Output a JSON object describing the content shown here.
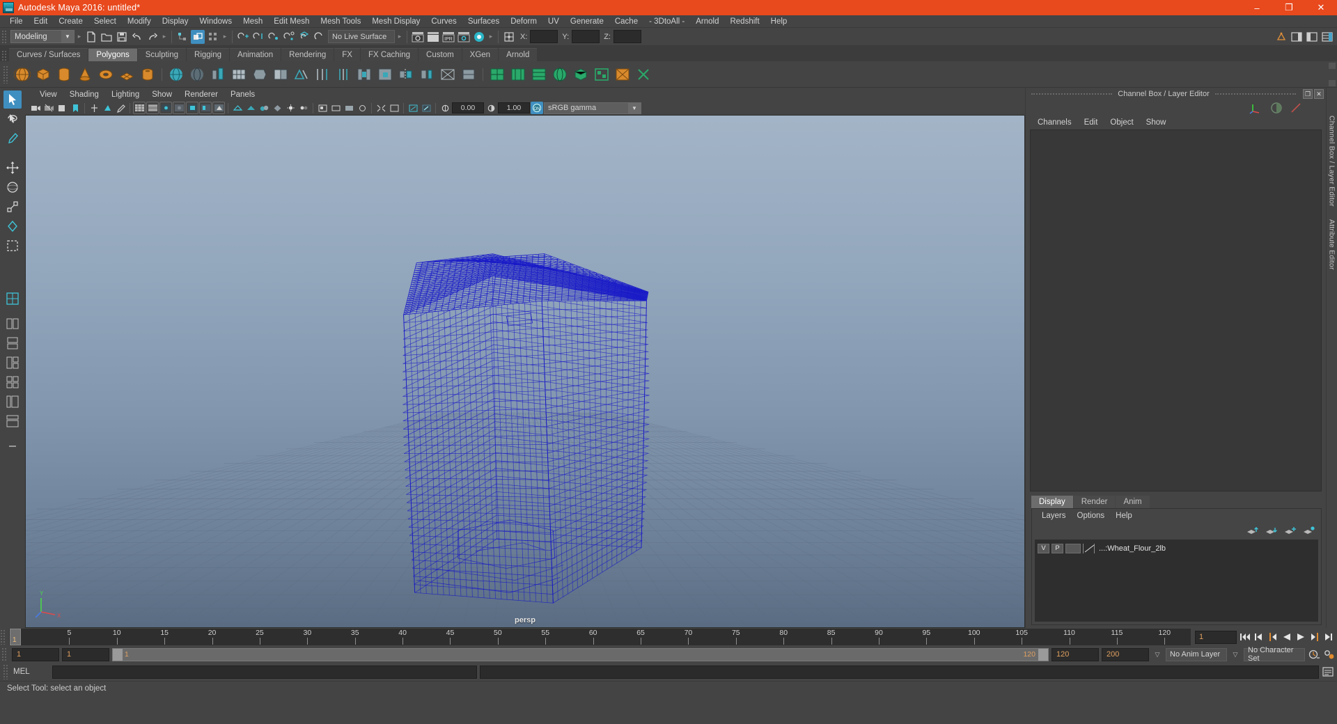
{
  "window": {
    "title": "Autodesk Maya 2016: untitled*",
    "minimize": "–",
    "maximize": "❐",
    "close": "✕",
    "titlebar_color": "#e8491d"
  },
  "menubar": {
    "items": [
      "File",
      "Edit",
      "Create",
      "Select",
      "Modify",
      "Display",
      "Windows",
      "Mesh",
      "Edit Mesh",
      "Mesh Tools",
      "Mesh Display",
      "Curves",
      "Surfaces",
      "Deform",
      "UV",
      "Generate",
      "Cache",
      "- 3DtoAll -",
      "Arnold",
      "Redshift",
      "Help"
    ]
  },
  "statusline": {
    "menu_set": "Modeling",
    "live_surface": "No Live Surface",
    "coord_x_label": "X:",
    "coord_y_label": "Y:",
    "coord_z_label": "Z:",
    "coord_x_value": "",
    "coord_y_value": "",
    "coord_z_value": "",
    "active_snap_icon": "snap-to-grid-icon"
  },
  "shelf": {
    "tabs": [
      {
        "label": "Curves / Surfaces",
        "selected": false
      },
      {
        "label": "Polygons",
        "selected": true
      },
      {
        "label": "Sculpting",
        "selected": false
      },
      {
        "label": "Rigging",
        "selected": false
      },
      {
        "label": "Animation",
        "selected": false
      },
      {
        "label": "Rendering",
        "selected": false
      },
      {
        "label": "FX",
        "selected": false
      },
      {
        "label": "FX Caching",
        "selected": false
      },
      {
        "label": "Custom",
        "selected": false
      },
      {
        "label": "XGen",
        "selected": false
      },
      {
        "label": "Arnold",
        "selected": false
      }
    ]
  },
  "viewport": {
    "menus": [
      "View",
      "Shading",
      "Lighting",
      "Show",
      "Renderer",
      "Panels"
    ],
    "camera_label": "persp",
    "exposure_value": "0.00",
    "gamma_value": "1.00",
    "color_management": "sRGB gamma",
    "toggle_on_label": "ON",
    "wireframe_color": "#1a1ad0",
    "background_top": "#9fb0c4",
    "background_bottom": "#5d6f85"
  },
  "channelbox": {
    "panel_title": "Channel Box / Layer Editor",
    "menus": [
      "Channels",
      "Edit",
      "Object",
      "Show"
    ],
    "restore_glyph": "❐",
    "close_glyph": "✕"
  },
  "layer_editor": {
    "tabs": [
      {
        "label": "Display",
        "selected": true
      },
      {
        "label": "Render",
        "selected": false
      },
      {
        "label": "Anim",
        "selected": false
      }
    ],
    "menus": [
      "Layers",
      "Options",
      "Help"
    ],
    "layers": [
      {
        "visibility": "V",
        "playback": "P",
        "display_type": "",
        "name": "...:Wheat_Flour_2lb"
      }
    ]
  },
  "right_tabs": [
    "Channel Box / Layer Editor",
    "Attribute Editor"
  ],
  "timeline": {
    "ticks": [
      {
        "value": "5",
        "frame": 5
      },
      {
        "value": "10",
        "frame": 10
      },
      {
        "value": "15",
        "frame": 15
      },
      {
        "value": "20",
        "frame": 20
      },
      {
        "value": "25",
        "frame": 25
      },
      {
        "value": "30",
        "frame": 30
      },
      {
        "value": "35",
        "frame": 35
      },
      {
        "value": "40",
        "frame": 40
      },
      {
        "value": "45",
        "frame": 45
      },
      {
        "value": "50",
        "frame": 50
      },
      {
        "value": "55",
        "frame": 55
      },
      {
        "value": "60",
        "frame": 60
      },
      {
        "value": "65",
        "frame": 65
      },
      {
        "value": "70",
        "frame": 70
      },
      {
        "value": "75",
        "frame": 75
      },
      {
        "value": "80",
        "frame": 80
      },
      {
        "value": "85",
        "frame": 85
      },
      {
        "value": "90",
        "frame": 90
      },
      {
        "value": "95",
        "frame": 95
      },
      {
        "value": "100",
        "frame": 100
      },
      {
        "value": "105",
        "frame": 105
      },
      {
        "value": "110",
        "frame": 110
      },
      {
        "value": "115",
        "frame": 115
      },
      {
        "value": "120",
        "frame": 120
      }
    ],
    "playhead_frame": "1",
    "current_frame": "1",
    "range_start": "1",
    "range_end": "1",
    "range_bar_start": "1",
    "range_bar_end": "120",
    "playback_end": "120",
    "anim_end": "200",
    "anim_layer": "No Anim Layer",
    "character_set": "No Character Set"
  },
  "mel": {
    "label": "MEL",
    "command_value": "",
    "output_value": ""
  },
  "helpline": {
    "text": "Select Tool: select an object"
  }
}
